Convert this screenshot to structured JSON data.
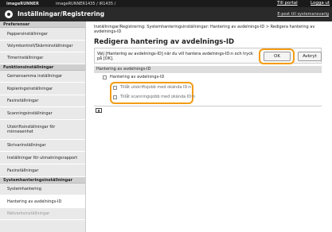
{
  "topbar": {
    "brand": "imageRUNNER",
    "model": "imageRUNNER1435 / iR1435 /",
    "portal_link": "Till portal",
    "logout_link": "Logga ut"
  },
  "header": {
    "title": "Inställningar/Registrering",
    "email_link": "E-post till systemansvarig"
  },
  "sidebar": {
    "sections": [
      {
        "heading": "Preferenser",
        "items": [
          "Pappersinställningar",
          "Volymkontroll/Skärminställningar",
          "Timerinställningar"
        ]
      },
      {
        "heading": "Funktionsinställningar",
        "items": [
          "Gemensamma inställningar",
          "Kopieringsinställningar",
          "Faxinställningar",
          "Scanningsinställningar",
          "Utskriftsinställningar för minnesenhet",
          "Skrivarinställningar",
          "Inställningar för utmatningsrapport",
          "Faxinställningar"
        ]
      },
      {
        "heading": "Systemhanteringsinställningar",
        "items": [
          "Systemhantering",
          "Hantering av avdelnings-ID",
          "Nätverksinställningar"
        ]
      }
    ]
  },
  "main": {
    "breadcrumb": "Inställningar/Registrering: Systemhanteringsinställningar: Hantering av avdelnings-ID > Redigera hantering av avdelnings-ID",
    "title": "Redigera hantering av avdelnings-ID",
    "instruction": "Välj [Hantering av avdelnings-ID] när du vill hantera avdelnings-ID:n och tryck på [OK].",
    "ok_label": "OK",
    "cancel_label": "Avbryt",
    "section_heading": "Hantering av avdelnings-ID",
    "options": {
      "enable": "Hantering av avdelnings-ID",
      "unknown_print": "Tillåt utskriftsjobb med okända ID:n",
      "unknown_scan": "Tillåt scanningsjobb med okända ID:n"
    },
    "back_to_top": "▲"
  }
}
